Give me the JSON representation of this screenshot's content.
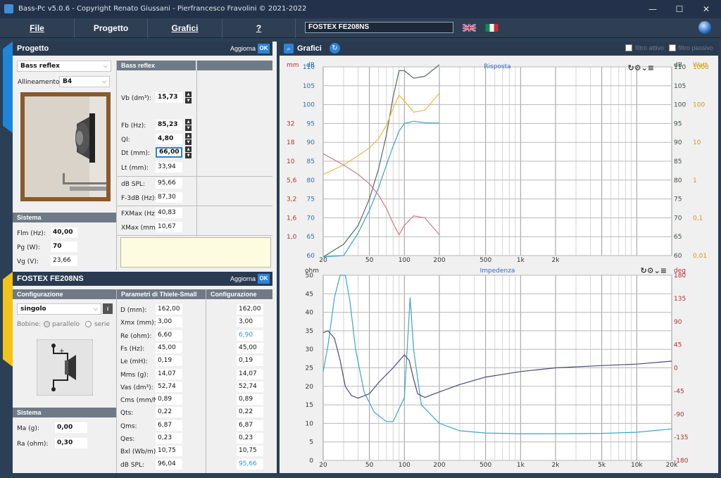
{
  "window": {
    "title": "Bass-Pc v5.0.6 - Copyright Renato Giussani - Pierfrancesco Fravolini © 2021-2022",
    "minimize": "—",
    "maximize": "☐",
    "close": "✕"
  },
  "menu": {
    "file": "File",
    "progetto": "Progetto",
    "grafici": "Grafici",
    "help": "?",
    "speaker_name": "FOSTEX FE208NS"
  },
  "progetto": {
    "header": "Progetto",
    "aggiorna": "Aggiorna",
    "ok": "OK",
    "type": "Bass reflex",
    "allineamento_label": "Allineamento:",
    "allineamento": "B4",
    "box_header": "Bass reflex",
    "fields": [
      {
        "label": "Vb (dm³):",
        "value": "15,73"
      },
      {
        "label": "Fb (Hz):",
        "value": "85,23"
      },
      {
        "label": "Ql:",
        "value": "4,80"
      },
      {
        "label": "Dt (mm):",
        "value": "66,00"
      },
      {
        "label": "Lt (mm):",
        "value": "33,94"
      }
    ],
    "results": [
      {
        "label": "dB SPL:",
        "value": "95,66"
      },
      {
        "label": "F-3dB (Hz):",
        "value": "87,30"
      },
      {
        "label": "FXMax (Hz):",
        "value": "40,83"
      },
      {
        "label": "XMax (mm):",
        "value": "10,67"
      }
    ],
    "sistema_header": "Sistema",
    "sistema": [
      {
        "label": "Flm (Hz):",
        "value": "40,00"
      },
      {
        "label": "Pg (W):",
        "value": "70"
      },
      {
        "label": "Vg (V):",
        "value": "23,66"
      }
    ]
  },
  "driver": {
    "header": "FOSTEX FE208NS",
    "aggiorna": "Aggiorna",
    "ok": "OK",
    "config_header": "Configurazione",
    "config": "singolo",
    "bobine_label": "Bobine:",
    "parallelo": "parallelo",
    "serie": "serie",
    "ts_header": "Parametri di Thiele-Small",
    "config_col_header": "Configurazione",
    "params": [
      {
        "label": "D (mm):",
        "value": "162,00",
        "config": "162,00"
      },
      {
        "label": "Xmx (mm):",
        "value": "3,00",
        "config": "3,00"
      },
      {
        "label": "Re (ohm):",
        "value": "6,60",
        "config": "6,90"
      },
      {
        "label": "Fs (Hz):",
        "value": "45,00",
        "config": "45,00"
      },
      {
        "label": "Le (mH):",
        "value": "0,19",
        "config": "0,19"
      },
      {
        "label": "Mms (g):",
        "value": "14,07",
        "config": "14,07"
      },
      {
        "label": "Vas (dm³):",
        "value": "52,74",
        "config": "52,74"
      },
      {
        "label": "Cms (mm/N):",
        "value": "0,89",
        "config": "0,89"
      },
      {
        "label": "Qts:",
        "value": "0,22",
        "config": "0,22"
      },
      {
        "label": "Qms:",
        "value": "6,87",
        "config": "6,87"
      },
      {
        "label": "Qes:",
        "value": "0,23",
        "config": "0,23"
      },
      {
        "label": "Bxl (Wb/m):",
        "value": "10,75",
        "config": "10,75"
      },
      {
        "label": "dB SPL:",
        "value": "96,04",
        "config": "95,66"
      }
    ],
    "sistema_header": "Sistema",
    "sistema": [
      {
        "label": "Ma (g):",
        "value": "0,00"
      },
      {
        "label": "Ra (ohm):",
        "value": "0,30"
      }
    ]
  },
  "grafici": {
    "header": "Grafici",
    "filtro_attivo": "filtro attivo",
    "filtro_passivo": "filtro passivo"
  },
  "colors": {
    "spl": "#5a6a5e",
    "spl_closed": "#3aa6c9",
    "power": "#f0b840",
    "excursion": "#d07a80",
    "impedance": "#3aa6c9",
    "phase": "#4a4a7a"
  },
  "chart_data": [
    {
      "type": "line",
      "title": "Risposta",
      "x_scale": "log",
      "xlim": [
        20,
        20000
      ],
      "x_ticks": [
        "20",
        "50",
        "100",
        "200",
        "500",
        "1k",
        "2k"
      ],
      "axes": {
        "mm": {
          "unit": "mm",
          "ticks": [
            "32",
            "18",
            "10",
            "5,6",
            "3,2",
            "1,6",
            "1,0"
          ]
        },
        "db_left": {
          "unit": "dB",
          "ticks": [
            "110",
            "105",
            "100",
            "95",
            "90",
            "85",
            "80",
            "75",
            "70",
            "65",
            "60"
          ],
          "ylim": [
            60,
            110
          ]
        },
        "db_right": {
          "unit": "dB",
          "ticks": [
            "110",
            "105",
            "100",
            "95",
            "90",
            "85",
            "80",
            "75",
            "70",
            "65",
            "60"
          ]
        },
        "watt": {
          "unit": "Watt",
          "ticks": [
            "1000",
            "100",
            "10",
            "1",
            "0,1",
            "0,01"
          ]
        }
      },
      "series": [
        {
          "color": "spl",
          "x": [
            20,
            30,
            40,
            50,
            60,
            70,
            80,
            90,
            100,
            120,
            150,
            200
          ],
          "y": [
            58,
            63,
            68,
            75,
            83,
            92,
            102,
            109,
            109,
            107,
            107.5,
            111
          ]
        },
        {
          "color": "spl_closed",
          "x": [
            20,
            30,
            40,
            50,
            60,
            70,
            80,
            90,
            100,
            120,
            150,
            200
          ],
          "y": [
            56,
            60,
            66,
            72,
            78,
            84,
            89,
            93,
            95,
            95.6,
            95.2,
            95.1
          ]
        },
        {
          "color": "power",
          "x": [
            20,
            30,
            40,
            50,
            60,
            70,
            80,
            90,
            100,
            120,
            150,
            200
          ],
          "y": [
            81.5,
            84,
            86.5,
            88.5,
            91,
            94.5,
            99,
            102.5,
            101,
            98,
            98.5,
            103
          ]
        },
        {
          "color": "excursion",
          "x": [
            20,
            30,
            40,
            50,
            60,
            70,
            80,
            90,
            100,
            120,
            150,
            200
          ],
          "y": [
            87,
            84,
            81.5,
            79,
            76,
            72.5,
            68.5,
            65.5,
            68,
            70.5,
            70,
            65.5
          ]
        }
      ]
    },
    {
      "type": "line",
      "title": "Impedenza",
      "x_scale": "log",
      "xlim": [
        20,
        20000
      ],
      "x_ticks": [
        "20",
        "50",
        "100",
        "200",
        "500",
        "1k",
        "2k",
        "5k",
        "10k",
        "20k"
      ],
      "axes": {
        "ohm": {
          "unit": "ohm",
          "ticks": [
            "50",
            "45",
            "40",
            "35",
            "30",
            "25",
            "20",
            "15",
            "10",
            "5",
            "0"
          ],
          "ylim": [
            0,
            50
          ]
        },
        "deg": {
          "unit": "deg",
          "ticks": [
            "180",
            "135",
            "90",
            "45",
            "0",
            "-45",
            "-90",
            "-135",
            "-180"
          ],
          "ylim": [
            -180,
            180
          ]
        }
      },
      "series": [
        {
          "color": "impedance",
          "x": [
            20,
            22,
            25,
            28,
            31,
            34,
            38,
            45,
            55,
            70,
            80,
            100,
            112,
            120,
            140,
            200,
            300,
            500,
            1000,
            2000,
            5000,
            10000,
            20000
          ],
          "y": [
            24,
            31,
            44,
            60,
            60,
            43,
            30,
            18.5,
            13,
            10.5,
            10.5,
            17,
            44,
            30,
            15,
            10,
            8,
            7.4,
            7.2,
            7.2,
            7.3,
            7.6,
            8.5
          ]
        },
        {
          "color": "phase",
          "x": [
            20,
            22,
            25,
            28,
            31,
            35,
            40,
            50,
            60,
            80,
            100,
            110,
            120,
            130,
            150,
            200,
            300,
            500,
            1000,
            2000,
            5000,
            10000,
            20000
          ],
          "y": [
            34.5,
            35,
            33,
            27,
            20,
            17.5,
            16.8,
            18,
            21,
            25,
            28.5,
            27,
            22,
            18,
            17,
            18.5,
            20.5,
            22.5,
            24,
            25,
            25.6,
            26,
            26.8
          ]
        }
      ]
    }
  ]
}
